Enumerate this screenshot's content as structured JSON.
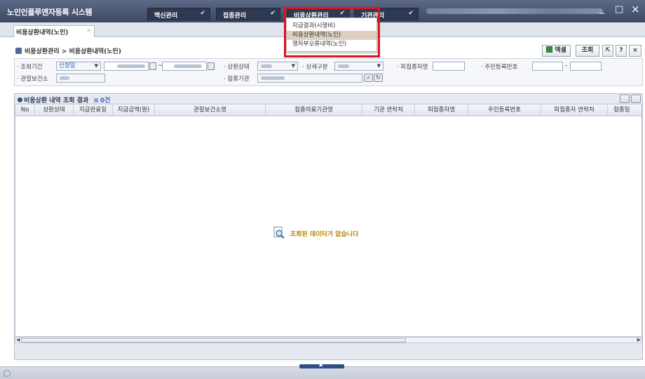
{
  "app": {
    "title": "노인인플루엔자등록 시스템"
  },
  "nav": {
    "menus": [
      {
        "label": "백신관리"
      },
      {
        "label": "접종관리"
      },
      {
        "label": "비용상환관리"
      },
      {
        "label": "기관관리"
      }
    ],
    "dropdown": {
      "items": [
        {
          "label": "지급결과(시행비)"
        },
        {
          "label": "비용상환내역(노인)"
        },
        {
          "label": "행자부오류내역(노인)"
        }
      ]
    }
  },
  "window": {
    "minimize": "_",
    "maximize": "□",
    "close": "×"
  },
  "tab": {
    "label": "비용상환내역(노인)",
    "close": "×"
  },
  "breadcrumb": {
    "text": "비용상환관리 > 비용상환내역(노인)"
  },
  "toolbar": {
    "excel": "엑셀",
    "search": "조회",
    "export_icon": "⇱",
    "help": "?",
    "close": "×"
  },
  "search": {
    "period_label": "· 조회기간",
    "period_type": "신청일",
    "period_sep": "~",
    "status_label": "· 상환상태",
    "detail_label": "· 상세구분",
    "vaccinee_label": "· 피접종자명",
    "rrn_label": "· 주민등록번호",
    "rrn_sep": "-",
    "health_center_label": "· 관할보건소",
    "institution_label": "· 접종기관"
  },
  "grid": {
    "title": "비용상환 내역 조회 결과",
    "count": "0건",
    "columns": [
      "No",
      "상환상태",
      "지급완료일",
      "지급금액(원)",
      "관할보건소명",
      "접종의료기관명",
      "기관 연락처",
      "피접종자명",
      "주민등록번호",
      "피접종자 연락처",
      "접종일"
    ],
    "empty_message": "조회된 데이터가 없습니다"
  },
  "colors": {
    "highlight": "#e0141c",
    "titlebar": "#4a5573",
    "accent": "#2c4f86"
  }
}
